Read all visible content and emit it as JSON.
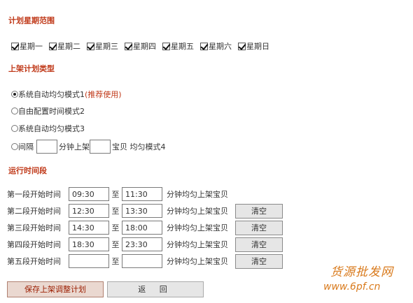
{
  "sections": {
    "week_title": "计划星期范围",
    "type_title": "上架计划类型",
    "time_title": "运行时间段"
  },
  "weekdays": [
    "星期一",
    "星期二",
    "星期三",
    "星期四",
    "星期五",
    "星期六",
    "星期日"
  ],
  "modes": {
    "m1": "系统自动均匀模式1",
    "m1_hint": "(推荐使用)",
    "m2": "自由配置时间模式2",
    "m3": "系统自动均匀模式3",
    "m4_prefix": "间隔",
    "m4_mid": "分钟上架",
    "m4_suffix": "宝贝 均匀模式4"
  },
  "periods": [
    {
      "label": "第一段开始时间",
      "start": "09:30",
      "sep": "至",
      "end": "11:30",
      "desc": "分钟均匀上架宝贝",
      "clear": ""
    },
    {
      "label": "第二段开始时间",
      "start": "12:30",
      "sep": "至",
      "end": "13:30",
      "desc": "分钟均匀上架宝贝",
      "clear": "清空"
    },
    {
      "label": "第三段开始时间",
      "start": "14:30",
      "sep": "至",
      "end": "18:00",
      "desc": "分钟均匀上架宝贝",
      "clear": "清空"
    },
    {
      "label": "第四段开始时间",
      "start": "18:30",
      "sep": "至",
      "end": "23:30",
      "desc": "分钟均匀上架宝贝",
      "clear": "清空"
    },
    {
      "label": "第五段开始时间",
      "start": "",
      "sep": "至",
      "end": "",
      "desc": "分钟均匀上架宝贝",
      "clear": "清空"
    }
  ],
  "buttons": {
    "save": "保存上架调整计划",
    "back": "返 回"
  },
  "watermark": {
    "line1": "货源批发网",
    "line2": "www.6pf.cn"
  },
  "colors": {
    "accent": "#c03a1a",
    "watermark": "#d97a1c"
  }
}
